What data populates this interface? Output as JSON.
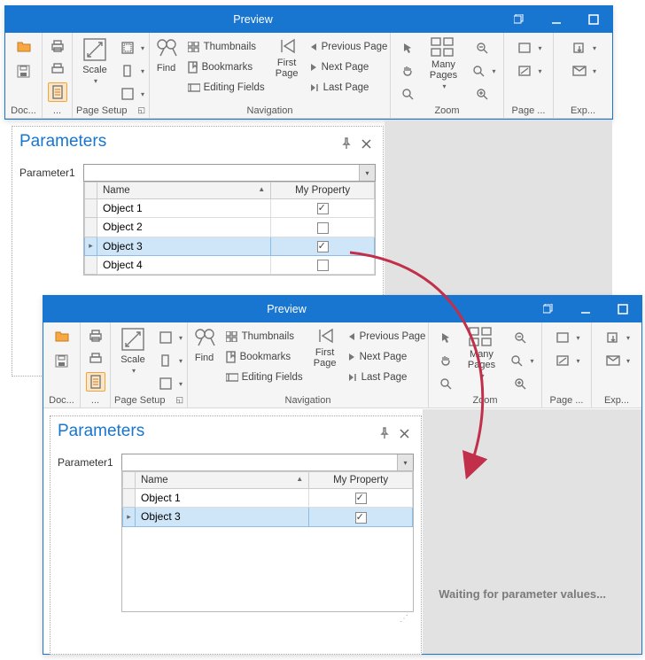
{
  "window1": {
    "title": "Preview",
    "ribbon": {
      "doc_label": "Doc...",
      "pagesetup_label": "Page Setup",
      "scale_label": "Scale",
      "nav_label": "Navigation",
      "find_label": "Find",
      "thumbnails": "Thumbnails",
      "bookmarks": "Bookmarks",
      "editing_fields": "Editing Fields",
      "first_page": "First",
      "first_page2": "Page",
      "prev_page": "Previous Page",
      "next_page": "Next  Page",
      "last_page": "Last  Page",
      "zoom_label": "Zoom",
      "many_pages": "Many Pages",
      "pagecol_label": "Page ...",
      "export_label": "Exp..."
    },
    "panel": {
      "title": "Parameters",
      "paramName": "Parameter1",
      "cols": {
        "name": "Name",
        "prop": "My Property"
      },
      "rows": [
        {
          "name": "Object 1",
          "checked": true,
          "sel": false
        },
        {
          "name": "Object 2",
          "checked": false,
          "sel": false
        },
        {
          "name": "Object 3",
          "checked": true,
          "sel": true
        },
        {
          "name": "Object 4",
          "checked": false,
          "sel": false
        }
      ]
    }
  },
  "window2": {
    "title": "Preview",
    "waiting": "Waiting for parameter values...",
    "panel": {
      "title": "Parameters",
      "paramName": "Parameter1",
      "cols": {
        "name": "Name",
        "prop": "My Property"
      },
      "rows": [
        {
          "name": "Object 1",
          "checked": true,
          "sel": false
        },
        {
          "name": "Object 3",
          "checked": true,
          "sel": true
        }
      ]
    }
  }
}
